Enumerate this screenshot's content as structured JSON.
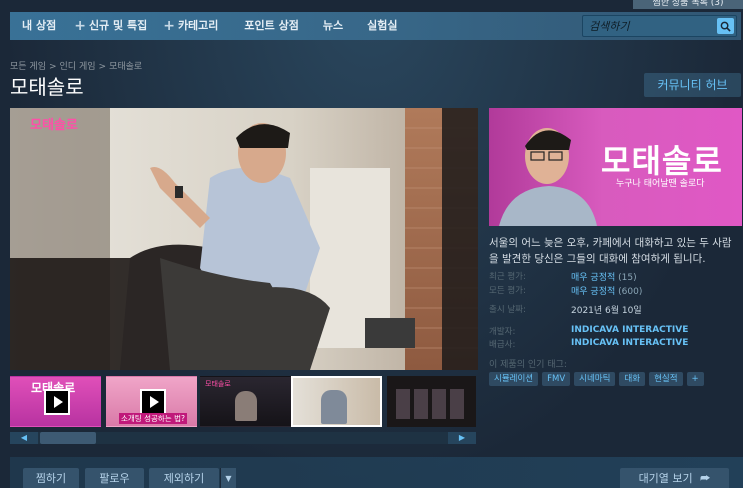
{
  "header": {
    "wishlist_label": "찜한 상품 목록 (3)"
  },
  "nav": {
    "items": [
      {
        "label": "내 상점",
        "plus": false
      },
      {
        "label": "신규 및 특집",
        "plus": true
      },
      {
        "label": "카테고리",
        "plus": true
      },
      {
        "label": "포인트 상점",
        "plus": false
      },
      {
        "label": "뉴스",
        "plus": false
      },
      {
        "label": "실험실",
        "plus": false
      }
    ],
    "search_placeholder": "검색하기"
  },
  "breadcrumb": [
    "모든 게임",
    "인디 게임",
    "모태솔로"
  ],
  "title": "모태솔로",
  "community_hub_label": "커뮤니티 허브",
  "video_overlay_logo": "모태솔로",
  "thumbnails": [
    {
      "kind": "video",
      "caption": "모태솔로"
    },
    {
      "kind": "video",
      "caption": "소개팅 성공하는 법?"
    },
    {
      "kind": "image",
      "caption": "모태솔로"
    },
    {
      "kind": "image",
      "caption": "",
      "active": true
    },
    {
      "kind": "image",
      "caption": ""
    }
  ],
  "capsule": {
    "title": "모태솔로",
    "subtitle": "누구나 태어날땐 솔로다"
  },
  "description": "서울의 어느 늦은 오후, 카페에서 대화하고 있는 두 사람을 발견한 당신은 그들의 대화에 참여하게 됩니다.",
  "reviews": {
    "recent_label": "최근 평가:",
    "recent_value": "매우 긍정적",
    "recent_count": "(15)",
    "all_label": "모든 평가:",
    "all_value": "매우 긍정적",
    "all_count": "(600)"
  },
  "release": {
    "label": "출시 날짜:",
    "value": "2021년 6월 10일"
  },
  "developer": {
    "label": "개발자:",
    "value": "INDICAVA INTERACTIVE"
  },
  "publisher": {
    "label": "배급사:",
    "value": "INDICAVA INTERACTIVE"
  },
  "tags_label": "이 제품의 인기 태그:",
  "tags": [
    "시뮬레이션",
    "FMV",
    "시네마틱",
    "대화",
    "현실적",
    "+"
  ],
  "actions": {
    "wishlist_add": "찜하기",
    "follow": "팔로우",
    "ignore": "제외하기",
    "queue": "대기열 보기"
  },
  "colors": {
    "accent": "#67c1f5",
    "background": "#1b2838",
    "capsule_pink": "#d85bbe"
  }
}
